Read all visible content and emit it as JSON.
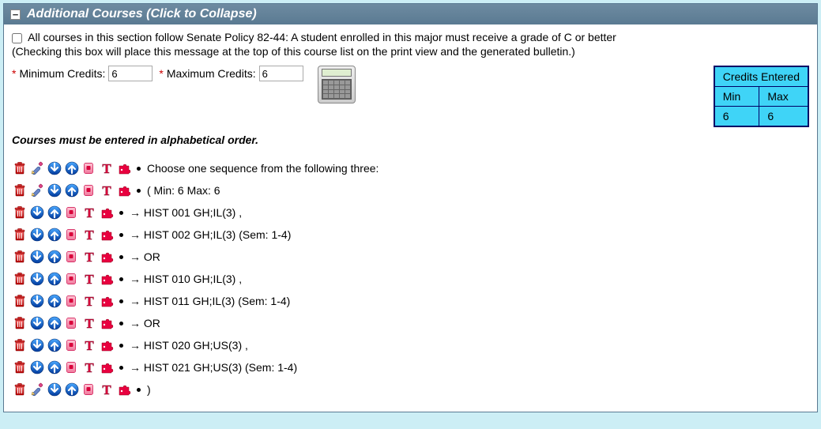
{
  "header": {
    "title": "Additional Courses (Click to Collapse)"
  },
  "policy": {
    "checkbox_label": "All courses in this section follow Senate Policy 82-44: A student enrolled in this major must receive a grade of C or better",
    "sub": "(Checking this box will place this message at the top of this course list on the print view and the generated bulletin.)"
  },
  "credits": {
    "min_label": "Minimum Credits:",
    "max_label": "Maximum Credits:",
    "min_value": "6",
    "max_value": "6"
  },
  "alpha_note": "Courses must be entered in alphabetical order.",
  "summary": {
    "header": "Credits Entered",
    "min_h": "Min",
    "max_h": "Max",
    "min_v": "6",
    "max_v": "6"
  },
  "rows": [
    {
      "has_edit": true,
      "text": "Choose one sequence from the following three:"
    },
    {
      "has_edit": true,
      "text": "( Min: 6 Max: 6"
    },
    {
      "has_edit": false,
      "text": "→ HIST 001 GH;IL(3) ,"
    },
    {
      "has_edit": false,
      "text": "→ HIST 002 GH;IL(3) (Sem: 1-4)"
    },
    {
      "has_edit": false,
      "text": "→ OR"
    },
    {
      "has_edit": false,
      "text": "→ HIST 010 GH;IL(3) ,"
    },
    {
      "has_edit": false,
      "text": "→ HIST 011 GH;IL(3) (Sem: 1-4)"
    },
    {
      "has_edit": false,
      "text": "→ OR"
    },
    {
      "has_edit": false,
      "text": "→ HIST 020 GH;US(3) ,"
    },
    {
      "has_edit": false,
      "text": "→ HIST 021 GH;US(3) (Sem: 1-4)"
    },
    {
      "has_edit": true,
      "text": ")"
    }
  ],
  "icons": {
    "delete": "trash-icon",
    "edit": "pencil-icon",
    "down": "arrow-down-icon",
    "up": "arrow-up-icon",
    "copy": "copy-icon",
    "text": "text-t-icon",
    "insert": "puzzle-icon"
  }
}
